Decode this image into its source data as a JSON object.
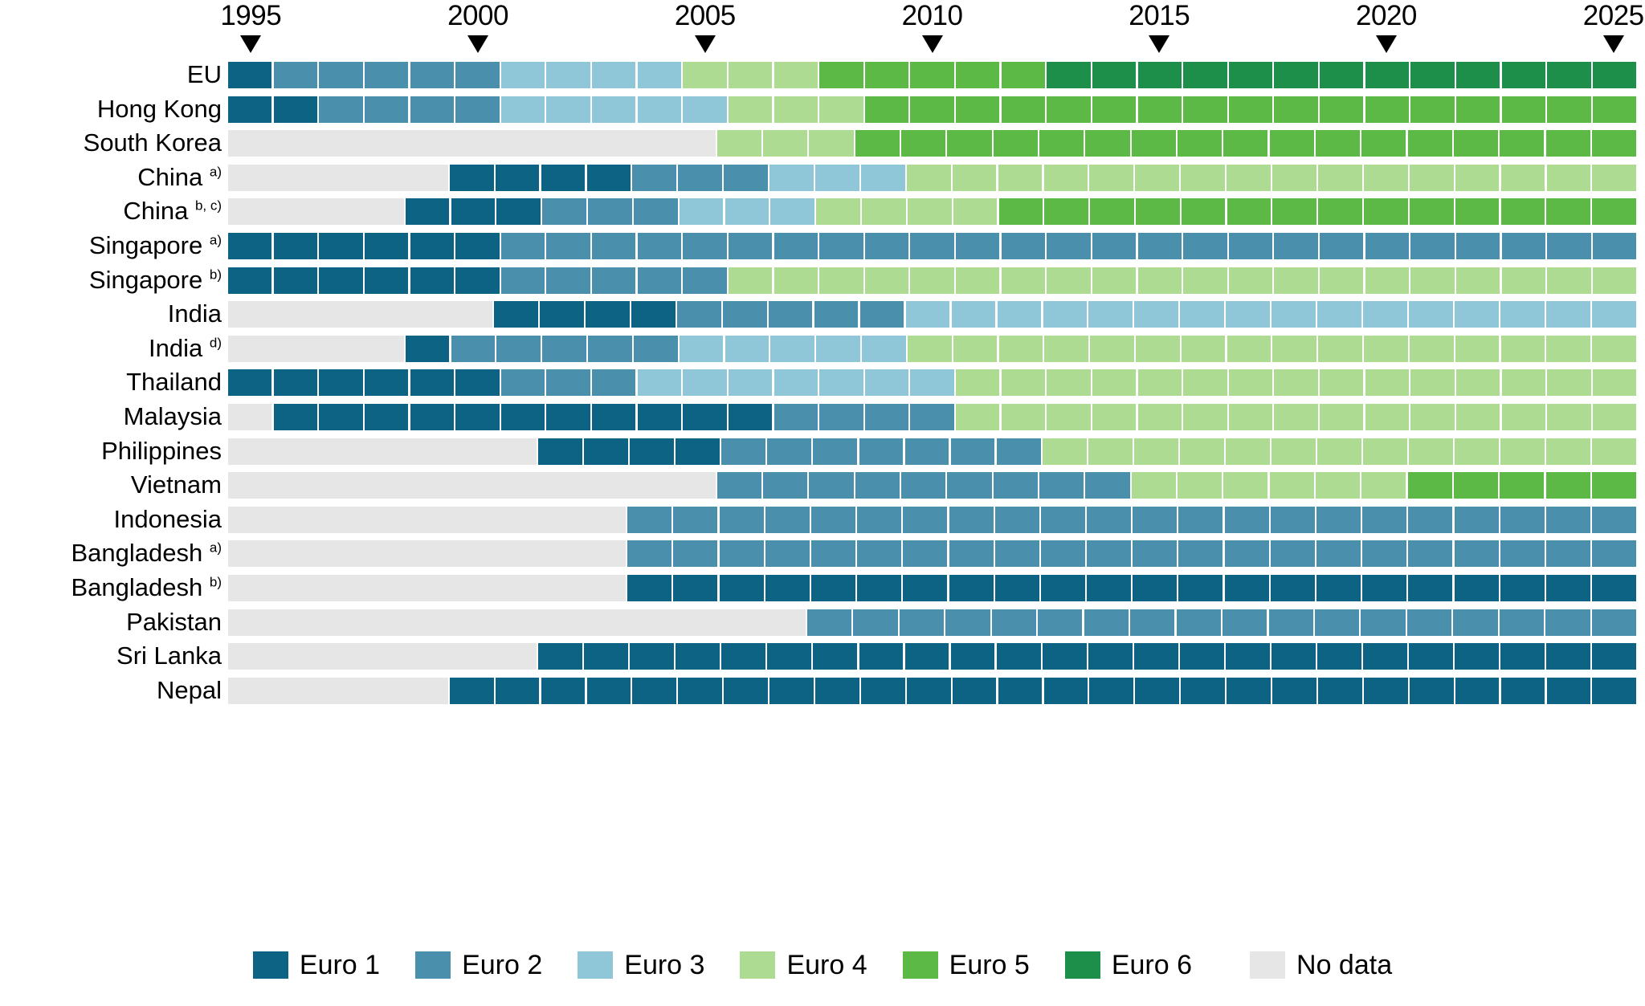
{
  "axis": {
    "year_ticks": [
      {
        "label": "1995",
        "year": 1995
      },
      {
        "label": "2000",
        "year": 2000
      },
      {
        "label": "2005",
        "year": 2005
      },
      {
        "label": "2010",
        "year": 2010
      },
      {
        "label": "2015",
        "year": 2015
      },
      {
        "label": "2020",
        "year": 2020
      },
      {
        "label": "2025",
        "year": 2025
      }
    ]
  },
  "legend": {
    "items": [
      {
        "label": "Euro 1",
        "key": "euro1",
        "color": "#0d6383"
      },
      {
        "label": "Euro 2",
        "key": "euro2",
        "color": "#4a8fab"
      },
      {
        "label": "Euro 3",
        "key": "euro3",
        "color": "#8fc6d8"
      },
      {
        "label": "Euro 4",
        "key": "euro4",
        "color": "#addb92"
      },
      {
        "label": "Euro 5",
        "key": "euro5",
        "color": "#5cb946"
      },
      {
        "label": "Euro 6",
        "key": "euro6",
        "color": "#1e8e4b"
      },
      {
        "label": "No data",
        "key": "nodata",
        "color": "#e6e6e6"
      }
    ]
  },
  "colors": {
    "euro1": "#0d6383",
    "euro2": "#4a8fab",
    "euro3": "#8fc6d8",
    "euro4": "#addb92",
    "euro5": "#5cb946",
    "euro6": "#1e8e4b",
    "nodata": "#e6e6e6"
  },
  "chart_data": {
    "type": "heatmap",
    "title": "",
    "xlabel": "",
    "ylabel": "",
    "x": [
      1995,
      1996,
      1997,
      1998,
      1999,
      2000,
      2001,
      2002,
      2003,
      2004,
      2005,
      2006,
      2007,
      2008,
      2009,
      2010,
      2011,
      2012,
      2013,
      2014,
      2015,
      2016,
      2017,
      2018,
      2019,
      2020,
      2021,
      2022,
      2023,
      2024,
      2025
    ],
    "x_range": [
      1995,
      2025
    ],
    "categories": [
      "EU",
      "Hong Kong",
      "South Korea",
      "China a)",
      "China b, c)",
      "Singapore a)",
      "Singapore b)",
      "India",
      "India d)",
      "Thailand",
      "Malaysia",
      "Philippines",
      "Vietnam",
      "Indonesia",
      "Bangladesh a)",
      "Bangladesh b)",
      "Pakistan",
      "Sri Lanka",
      "Nepal"
    ],
    "value_keys": [
      "euro1",
      "euro2",
      "euro3",
      "euro4",
      "euro5",
      "euro6",
      "nodata"
    ],
    "legend_position": "bottom",
    "grid": false,
    "rows": [
      {
        "name": "EU",
        "label": "EU",
        "footnote": "",
        "values": [
          "euro1",
          "euro2",
          "euro2",
          "euro2",
          "euro2",
          "euro2",
          "euro3",
          "euro3",
          "euro3",
          "euro3",
          "euro4",
          "euro4",
          "euro4",
          "euro5",
          "euro5",
          "euro5",
          "euro5",
          "euro5",
          "euro6",
          "euro6",
          "euro6",
          "euro6",
          "euro6",
          "euro6",
          "euro6",
          "euro6",
          "euro6",
          "euro6",
          "euro6",
          "euro6",
          "euro6"
        ]
      },
      {
        "name": "Hong Kong",
        "label": "Hong Kong",
        "footnote": "",
        "values": [
          "euro1",
          "euro1",
          "euro2",
          "euro2",
          "euro2",
          "euro2",
          "euro3",
          "euro3",
          "euro3",
          "euro3",
          "euro3",
          "euro4",
          "euro4",
          "euro4",
          "euro5",
          "euro5",
          "euro5",
          "euro5",
          "euro5",
          "euro5",
          "euro5",
          "euro5",
          "euro5",
          "euro5",
          "euro5",
          "euro5",
          "euro5",
          "euro5",
          "euro5",
          "euro5",
          "euro5"
        ]
      },
      {
        "name": "South Korea",
        "label": "South Korea",
        "footnote": "",
        "values": [
          "nodata",
          "nodata",
          "nodata",
          "nodata",
          "nodata",
          "nodata",
          "nodata",
          "nodata",
          "nodata",
          "nodata",
          "nodata",
          "euro4",
          "euro4",
          "euro4",
          "euro5",
          "euro5",
          "euro5",
          "euro5",
          "euro5",
          "euro5",
          "euro5",
          "euro5",
          "euro5",
          "euro5",
          "euro5",
          "euro5",
          "euro5",
          "euro5",
          "euro5",
          "euro5",
          "euro5"
        ]
      },
      {
        "name": "China a)",
        "label": "China",
        "footnote": "a)",
        "values": [
          "nodata",
          "nodata",
          "nodata",
          "nodata",
          "nodata",
          "euro1",
          "euro1",
          "euro1",
          "euro1",
          "euro2",
          "euro2",
          "euro2",
          "euro3",
          "euro3",
          "euro3",
          "euro4",
          "euro4",
          "euro4",
          "euro4",
          "euro4",
          "euro4",
          "euro4",
          "euro4",
          "euro4",
          "euro4",
          "euro4",
          "euro4",
          "euro4",
          "euro4",
          "euro4",
          "euro4"
        ]
      },
      {
        "name": "China b, c)",
        "label": "China",
        "footnote": "b, c)",
        "values": [
          "nodata",
          "nodata",
          "nodata",
          "nodata",
          "euro1",
          "euro1",
          "euro1",
          "euro2",
          "euro2",
          "euro2",
          "euro3",
          "euro3",
          "euro3",
          "euro4",
          "euro4",
          "euro4",
          "euro4",
          "euro5",
          "euro5",
          "euro5",
          "euro5",
          "euro5",
          "euro5",
          "euro5",
          "euro5",
          "euro5",
          "euro5",
          "euro5",
          "euro5",
          "euro5",
          "euro5"
        ]
      },
      {
        "name": "Singapore a)",
        "label": "Singapore",
        "footnote": "a)",
        "values": [
          "euro1",
          "euro1",
          "euro1",
          "euro1",
          "euro1",
          "euro1",
          "euro2",
          "euro2",
          "euro2",
          "euro2",
          "euro2",
          "euro2",
          "euro2",
          "euro2",
          "euro2",
          "euro2",
          "euro2",
          "euro2",
          "euro2",
          "euro2",
          "euro2",
          "euro2",
          "euro2",
          "euro2",
          "euro2",
          "euro2",
          "euro2",
          "euro2",
          "euro2",
          "euro2",
          "euro2"
        ]
      },
      {
        "name": "Singapore b)",
        "label": "Singapore",
        "footnote": "b)",
        "values": [
          "euro1",
          "euro1",
          "euro1",
          "euro1",
          "euro1",
          "euro1",
          "euro2",
          "euro2",
          "euro2",
          "euro2",
          "euro2",
          "euro4",
          "euro4",
          "euro4",
          "euro4",
          "euro4",
          "euro4",
          "euro4",
          "euro4",
          "euro4",
          "euro4",
          "euro4",
          "euro4",
          "euro4",
          "euro4",
          "euro4",
          "euro4",
          "euro4",
          "euro4",
          "euro4",
          "euro4"
        ]
      },
      {
        "name": "India",
        "label": "India",
        "footnote": "",
        "values": [
          "nodata",
          "nodata",
          "nodata",
          "nodata",
          "nodata",
          "nodata",
          "euro1",
          "euro1",
          "euro1",
          "euro1",
          "euro2",
          "euro2",
          "euro2",
          "euro2",
          "euro2",
          "euro3",
          "euro3",
          "euro3",
          "euro3",
          "euro3",
          "euro3",
          "euro3",
          "euro3",
          "euro3",
          "euro3",
          "euro3",
          "euro3",
          "euro3",
          "euro3",
          "euro3",
          "euro3"
        ]
      },
      {
        "name": "India d)",
        "label": "India",
        "footnote": "d)",
        "values": [
          "nodata",
          "nodata",
          "nodata",
          "nodata",
          "euro1",
          "euro2",
          "euro2",
          "euro2",
          "euro2",
          "euro2",
          "euro3",
          "euro3",
          "euro3",
          "euro3",
          "euro3",
          "euro4",
          "euro4",
          "euro4",
          "euro4",
          "euro4",
          "euro4",
          "euro4",
          "euro4",
          "euro4",
          "euro4",
          "euro4",
          "euro4",
          "euro4",
          "euro4",
          "euro4",
          "euro4"
        ]
      },
      {
        "name": "Thailand",
        "label": "Thailand",
        "footnote": "",
        "values": [
          "euro1",
          "euro1",
          "euro1",
          "euro1",
          "euro1",
          "euro1",
          "euro2",
          "euro2",
          "euro2",
          "euro3",
          "euro3",
          "euro3",
          "euro3",
          "euro3",
          "euro3",
          "euro3",
          "euro4",
          "euro4",
          "euro4",
          "euro4",
          "euro4",
          "euro4",
          "euro4",
          "euro4",
          "euro4",
          "euro4",
          "euro4",
          "euro4",
          "euro4",
          "euro4",
          "euro4"
        ]
      },
      {
        "name": "Malaysia",
        "label": "Malaysia",
        "footnote": "",
        "values": [
          "nodata",
          "euro1",
          "euro1",
          "euro1",
          "euro1",
          "euro1",
          "euro1",
          "euro1",
          "euro1",
          "euro1",
          "euro1",
          "euro1",
          "euro2",
          "euro2",
          "euro2",
          "euro2",
          "euro4",
          "euro4",
          "euro4",
          "euro4",
          "euro4",
          "euro4",
          "euro4",
          "euro4",
          "euro4",
          "euro4",
          "euro4",
          "euro4",
          "euro4",
          "euro4",
          "euro4"
        ]
      },
      {
        "name": "Philippines",
        "label": "Philippines",
        "footnote": "",
        "values": [
          "nodata",
          "nodata",
          "nodata",
          "nodata",
          "nodata",
          "nodata",
          "nodata",
          "euro1",
          "euro1",
          "euro1",
          "euro1",
          "euro2",
          "euro2",
          "euro2",
          "euro2",
          "euro2",
          "euro2",
          "euro2",
          "euro4",
          "euro4",
          "euro4",
          "euro4",
          "euro4",
          "euro4",
          "euro4",
          "euro4",
          "euro4",
          "euro4",
          "euro4",
          "euro4",
          "euro4"
        ]
      },
      {
        "name": "Vietnam",
        "label": "Vietnam",
        "footnote": "",
        "values": [
          "nodata",
          "nodata",
          "nodata",
          "nodata",
          "nodata",
          "nodata",
          "nodata",
          "nodata",
          "nodata",
          "nodata",
          "nodata",
          "euro2",
          "euro2",
          "euro2",
          "euro2",
          "euro2",
          "euro2",
          "euro2",
          "euro2",
          "euro2",
          "euro4",
          "euro4",
          "euro4",
          "euro4",
          "euro4",
          "euro4",
          "euro5",
          "euro5",
          "euro5",
          "euro5",
          "euro5"
        ]
      },
      {
        "name": "Indonesia",
        "label": "Indonesia",
        "footnote": "",
        "values": [
          "nodata",
          "nodata",
          "nodata",
          "nodata",
          "nodata",
          "nodata",
          "nodata",
          "nodata",
          "nodata",
          "euro2",
          "euro2",
          "euro2",
          "euro2",
          "euro2",
          "euro2",
          "euro2",
          "euro2",
          "euro2",
          "euro2",
          "euro2",
          "euro2",
          "euro2",
          "euro2",
          "euro2",
          "euro2",
          "euro2",
          "euro2",
          "euro2",
          "euro2",
          "euro2",
          "euro2"
        ]
      },
      {
        "name": "Bangladesh a)",
        "label": "Bangladesh",
        "footnote": "a)",
        "values": [
          "nodata",
          "nodata",
          "nodata",
          "nodata",
          "nodata",
          "nodata",
          "nodata",
          "nodata",
          "nodata",
          "euro2",
          "euro2",
          "euro2",
          "euro2",
          "euro2",
          "euro2",
          "euro2",
          "euro2",
          "euro2",
          "euro2",
          "euro2",
          "euro2",
          "euro2",
          "euro2",
          "euro2",
          "euro2",
          "euro2",
          "euro2",
          "euro2",
          "euro2",
          "euro2",
          "euro2"
        ]
      },
      {
        "name": "Bangladesh b)",
        "label": "Bangladesh",
        "footnote": "b)",
        "values": [
          "nodata",
          "nodata",
          "nodata",
          "nodata",
          "nodata",
          "nodata",
          "nodata",
          "nodata",
          "nodata",
          "euro1",
          "euro1",
          "euro1",
          "euro1",
          "euro1",
          "euro1",
          "euro1",
          "euro1",
          "euro1",
          "euro1",
          "euro1",
          "euro1",
          "euro1",
          "euro1",
          "euro1",
          "euro1",
          "euro1",
          "euro1",
          "euro1",
          "euro1",
          "euro1",
          "euro1"
        ]
      },
      {
        "name": "Pakistan",
        "label": "Pakistan",
        "footnote": "",
        "values": [
          "nodata",
          "nodata",
          "nodata",
          "nodata",
          "nodata",
          "nodata",
          "nodata",
          "nodata",
          "nodata",
          "nodata",
          "nodata",
          "nodata",
          "nodata",
          "euro2",
          "euro2",
          "euro2",
          "euro2",
          "euro2",
          "euro2",
          "euro2",
          "euro2",
          "euro2",
          "euro2",
          "euro2",
          "euro2",
          "euro2",
          "euro2",
          "euro2",
          "euro2",
          "euro2",
          "euro2"
        ]
      },
      {
        "name": "Sri Lanka",
        "label": "Sri Lanka",
        "footnote": "",
        "values": [
          "nodata",
          "nodata",
          "nodata",
          "nodata",
          "nodata",
          "nodata",
          "nodata",
          "euro1",
          "euro1",
          "euro1",
          "euro1",
          "euro1",
          "euro1",
          "euro1",
          "euro1",
          "euro1",
          "euro1",
          "euro1",
          "euro1",
          "euro1",
          "euro1",
          "euro1",
          "euro1",
          "euro1",
          "euro1",
          "euro1",
          "euro1",
          "euro1",
          "euro1",
          "euro1",
          "euro1"
        ]
      },
      {
        "name": "Nepal",
        "label": "Nepal",
        "footnote": "",
        "values": [
          "nodata",
          "nodata",
          "nodata",
          "nodata",
          "nodata",
          "euro1",
          "euro1",
          "euro1",
          "euro1",
          "euro1",
          "euro1",
          "euro1",
          "euro1",
          "euro1",
          "euro1",
          "euro1",
          "euro1",
          "euro1",
          "euro1",
          "euro1",
          "euro1",
          "euro1",
          "euro1",
          "euro1",
          "euro1",
          "euro1",
          "euro1",
          "euro1",
          "euro1",
          "euro1",
          "euro1"
        ]
      }
    ]
  }
}
